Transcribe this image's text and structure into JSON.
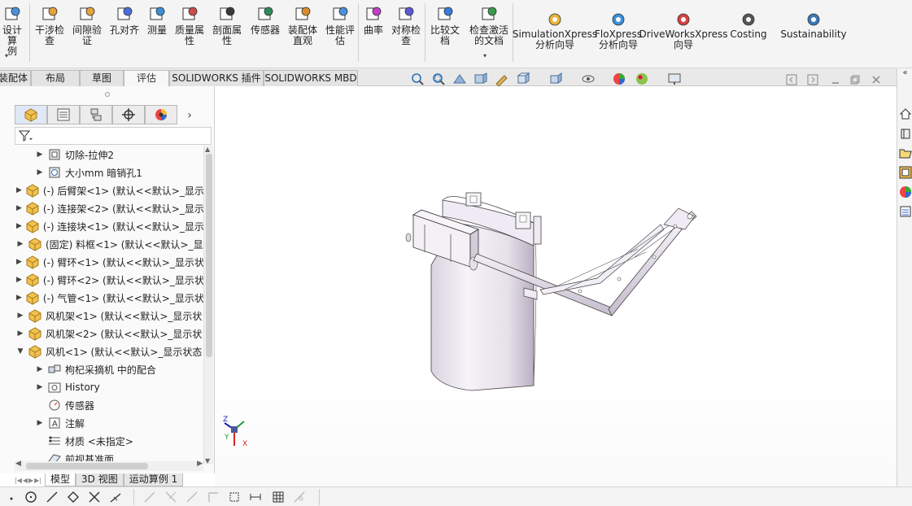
{
  "ribbon": {
    "buttons": [
      {
        "id": "design-study",
        "label": "设计算\n例",
        "icon": "design-study-icon"
      },
      {
        "id": "interference",
        "label": "干涉检\n查",
        "icon": "interference-icon"
      },
      {
        "id": "clearance",
        "label": "间隙验\n证",
        "icon": "clearance-icon"
      },
      {
        "id": "hole-align",
        "label": "孔对齐",
        "icon": "hole-align-icon"
      },
      {
        "id": "measure",
        "label": "测量",
        "icon": "measure-icon"
      },
      {
        "id": "mass-props",
        "label": "质量属\n性",
        "icon": "mass-props-icon"
      },
      {
        "id": "section-props",
        "label": "剖面属\n性",
        "icon": "section-props-icon"
      },
      {
        "id": "sensor",
        "label": "传感器",
        "icon": "sensor-icon"
      },
      {
        "id": "asm-visual",
        "label": "装配体\n直观",
        "icon": "asm-visual-icon"
      },
      {
        "id": "perf-eval",
        "label": "性能评\n估",
        "icon": "perf-eval-icon"
      },
      {
        "id": "curvature",
        "label": "曲率",
        "icon": "curvature-icon"
      },
      {
        "id": "symmetry",
        "label": "对称检\n查",
        "icon": "symmetry-icon"
      },
      {
        "id": "compare",
        "label": "比较文\n档",
        "icon": "compare-icon"
      },
      {
        "id": "check-active",
        "label": "检查激活\n的文档",
        "icon": "check-active-icon"
      }
    ],
    "xpress": [
      {
        "id": "simxpress",
        "label": "SimulationXpress\n分析向导",
        "icon": "simulationxpress-icon"
      },
      {
        "id": "floxpress",
        "label": "FloXpress\n分析向导",
        "icon": "floxpress-icon"
      },
      {
        "id": "driveworks",
        "label": "DriveWorksXpress\n向导",
        "icon": "driveworks-icon"
      },
      {
        "id": "costing",
        "label": "Costing",
        "icon": "costing-icon"
      },
      {
        "id": "sustainability",
        "label": "Sustainability",
        "icon": "sustainability-icon"
      }
    ]
  },
  "command_tabs": [
    "装配体",
    "布局",
    "草图",
    "评估",
    "SOLIDWORKS 插件",
    "SOLIDWORKS MBD"
  ],
  "active_command_tab": "评估",
  "feature_tree": {
    "rows": [
      {
        "indent": 1,
        "expand": "▶",
        "icon": "cut-extrude-icon",
        "text": "切除-拉伸2"
      },
      {
        "indent": 1,
        "expand": "▶",
        "icon": "hole-wizard-icon",
        "text": "大小mm 暗销孔1"
      },
      {
        "indent": 0,
        "expand": "▶",
        "icon": "part-icon",
        "text": "(-) 后臂架<1> (默认<<默认>_显示"
      },
      {
        "indent": 0,
        "expand": "▶",
        "icon": "part-icon",
        "text": "(-) 连接架<2> (默认<<默认>_显示"
      },
      {
        "indent": 0,
        "expand": "▶",
        "icon": "part-icon",
        "text": "(-) 连接块<1> (默认<<默认>_显示"
      },
      {
        "indent": 0,
        "expand": "▶",
        "icon": "part-icon",
        "text": "(固定) 料框<1> (默认<<默认>_显"
      },
      {
        "indent": 0,
        "expand": "▶",
        "icon": "part-icon",
        "text": "(-) 臂环<1> (默认<<默认>_显示状"
      },
      {
        "indent": 0,
        "expand": "▶",
        "icon": "part-icon",
        "text": "(-) 臂环<2> (默认<<默认>_显示状"
      },
      {
        "indent": 0,
        "expand": "▶",
        "icon": "part-icon",
        "text": "(-) 气管<1> (默认<<默认>_显示状"
      },
      {
        "indent": 0,
        "expand": "▶",
        "icon": "part-icon",
        "text": "风机架<1> (默认<<默认>_显示状"
      },
      {
        "indent": 0,
        "expand": "▶",
        "icon": "part-icon",
        "text": "风机架<2> (默认<<默认>_显示状"
      },
      {
        "indent": 0,
        "expand": "▼",
        "icon": "part-icon",
        "text": "风机<1> (默认<<默认>_显示状态"
      },
      {
        "indent": 1,
        "expand": "▶",
        "icon": "mates-icon",
        "text": "枸杞采摘机 中的配合"
      },
      {
        "indent": 1,
        "expand": "▶",
        "icon": "history-icon",
        "text": "History"
      },
      {
        "indent": 1,
        "expand": "",
        "icon": "sensor-icon",
        "text": "传感器"
      },
      {
        "indent": 1,
        "expand": "▶",
        "icon": "annotation-icon",
        "text": "注解"
      },
      {
        "indent": 1,
        "expand": "",
        "icon": "material-icon",
        "text": "材质 <未指定>"
      },
      {
        "indent": 1,
        "expand": "",
        "icon": "plane-icon",
        "text": "前视基准面"
      }
    ]
  },
  "bottom_tabs": [
    "模型",
    "3D 视图",
    "运动算例 1"
  ],
  "active_bottom_tab": "模型",
  "triad": {
    "x": "X",
    "y": "Y",
    "z": "Z"
  },
  "colors": {
    "accent": "#1f6fbf",
    "model_body": "#e9e4ec",
    "model_shade": "#b8aec0",
    "toolbar_bg": "#f4f4f4"
  }
}
